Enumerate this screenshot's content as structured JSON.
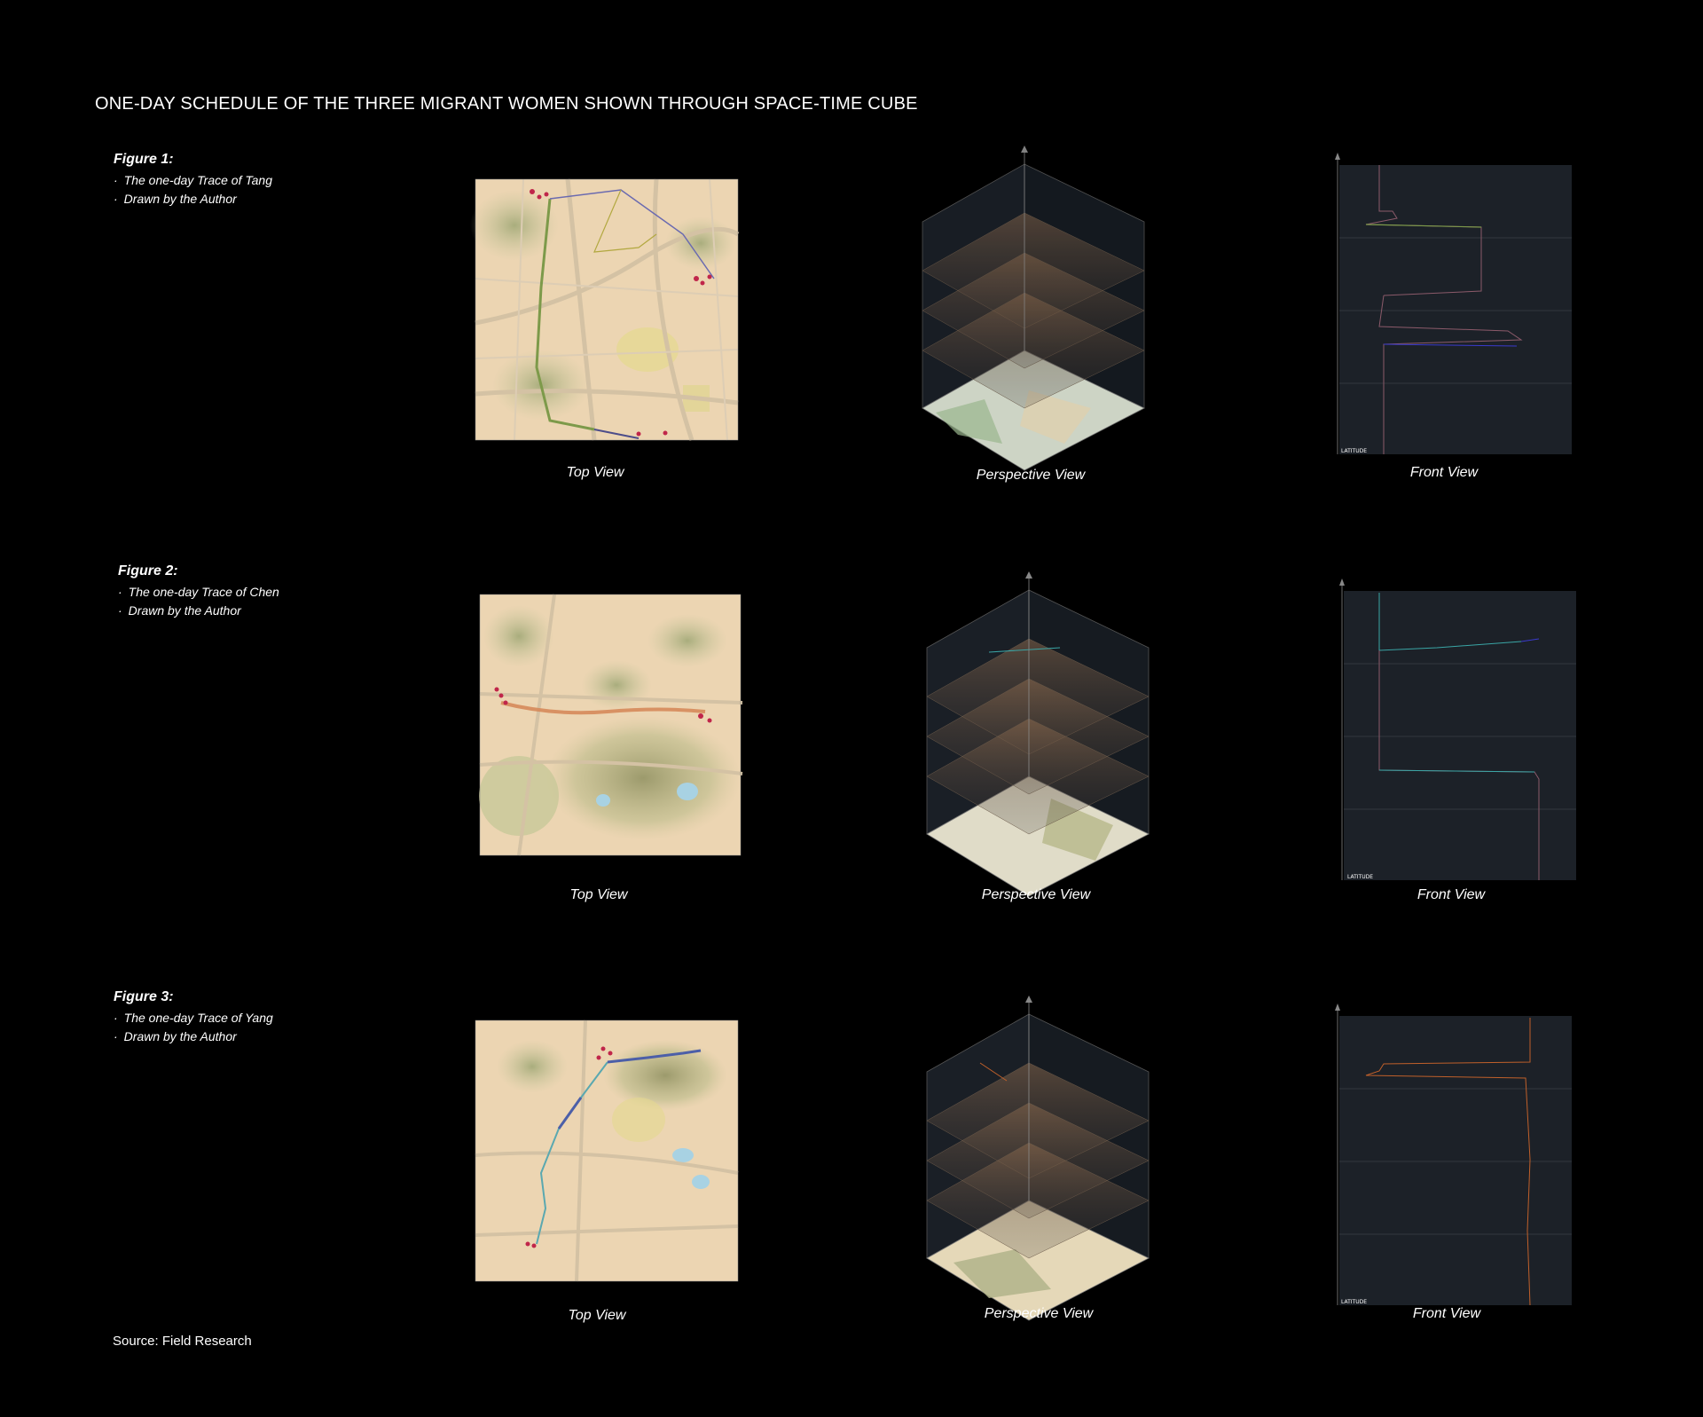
{
  "title": "ONE-DAY SCHEDULE OF THE THREE MIGRANT WOMEN SHOWN THROUGH SPACE-TIME CUBE",
  "source": "Source: Field Research",
  "view_labels": {
    "top": "Top View",
    "perspective": "Perspective View",
    "front": "Front View"
  },
  "front_axis_label": "LATITUDE",
  "colors": {
    "background": "#000000",
    "map_base": "#ecd5b2",
    "map_green": "#c5c79a",
    "cube_panel": "#1c2128",
    "trace_tang": "#7d9a4a",
    "trace_chen": "#d68a5a",
    "trace_yang": "#4c5fa8",
    "stop_marker": "#c0264a"
  },
  "figures": [
    {
      "title": "Figure 1:",
      "lines": [
        "The one-day Trace of Tang",
        "Drawn by the Author"
      ]
    },
    {
      "title": "Figure 2:",
      "lines": [
        "The one-day Trace of Chen",
        "Drawn by the Author"
      ]
    },
    {
      "title": "Figure 3:",
      "lines": [
        "The one-day Trace of Yang",
        "Drawn by the Author"
      ]
    }
  ]
}
